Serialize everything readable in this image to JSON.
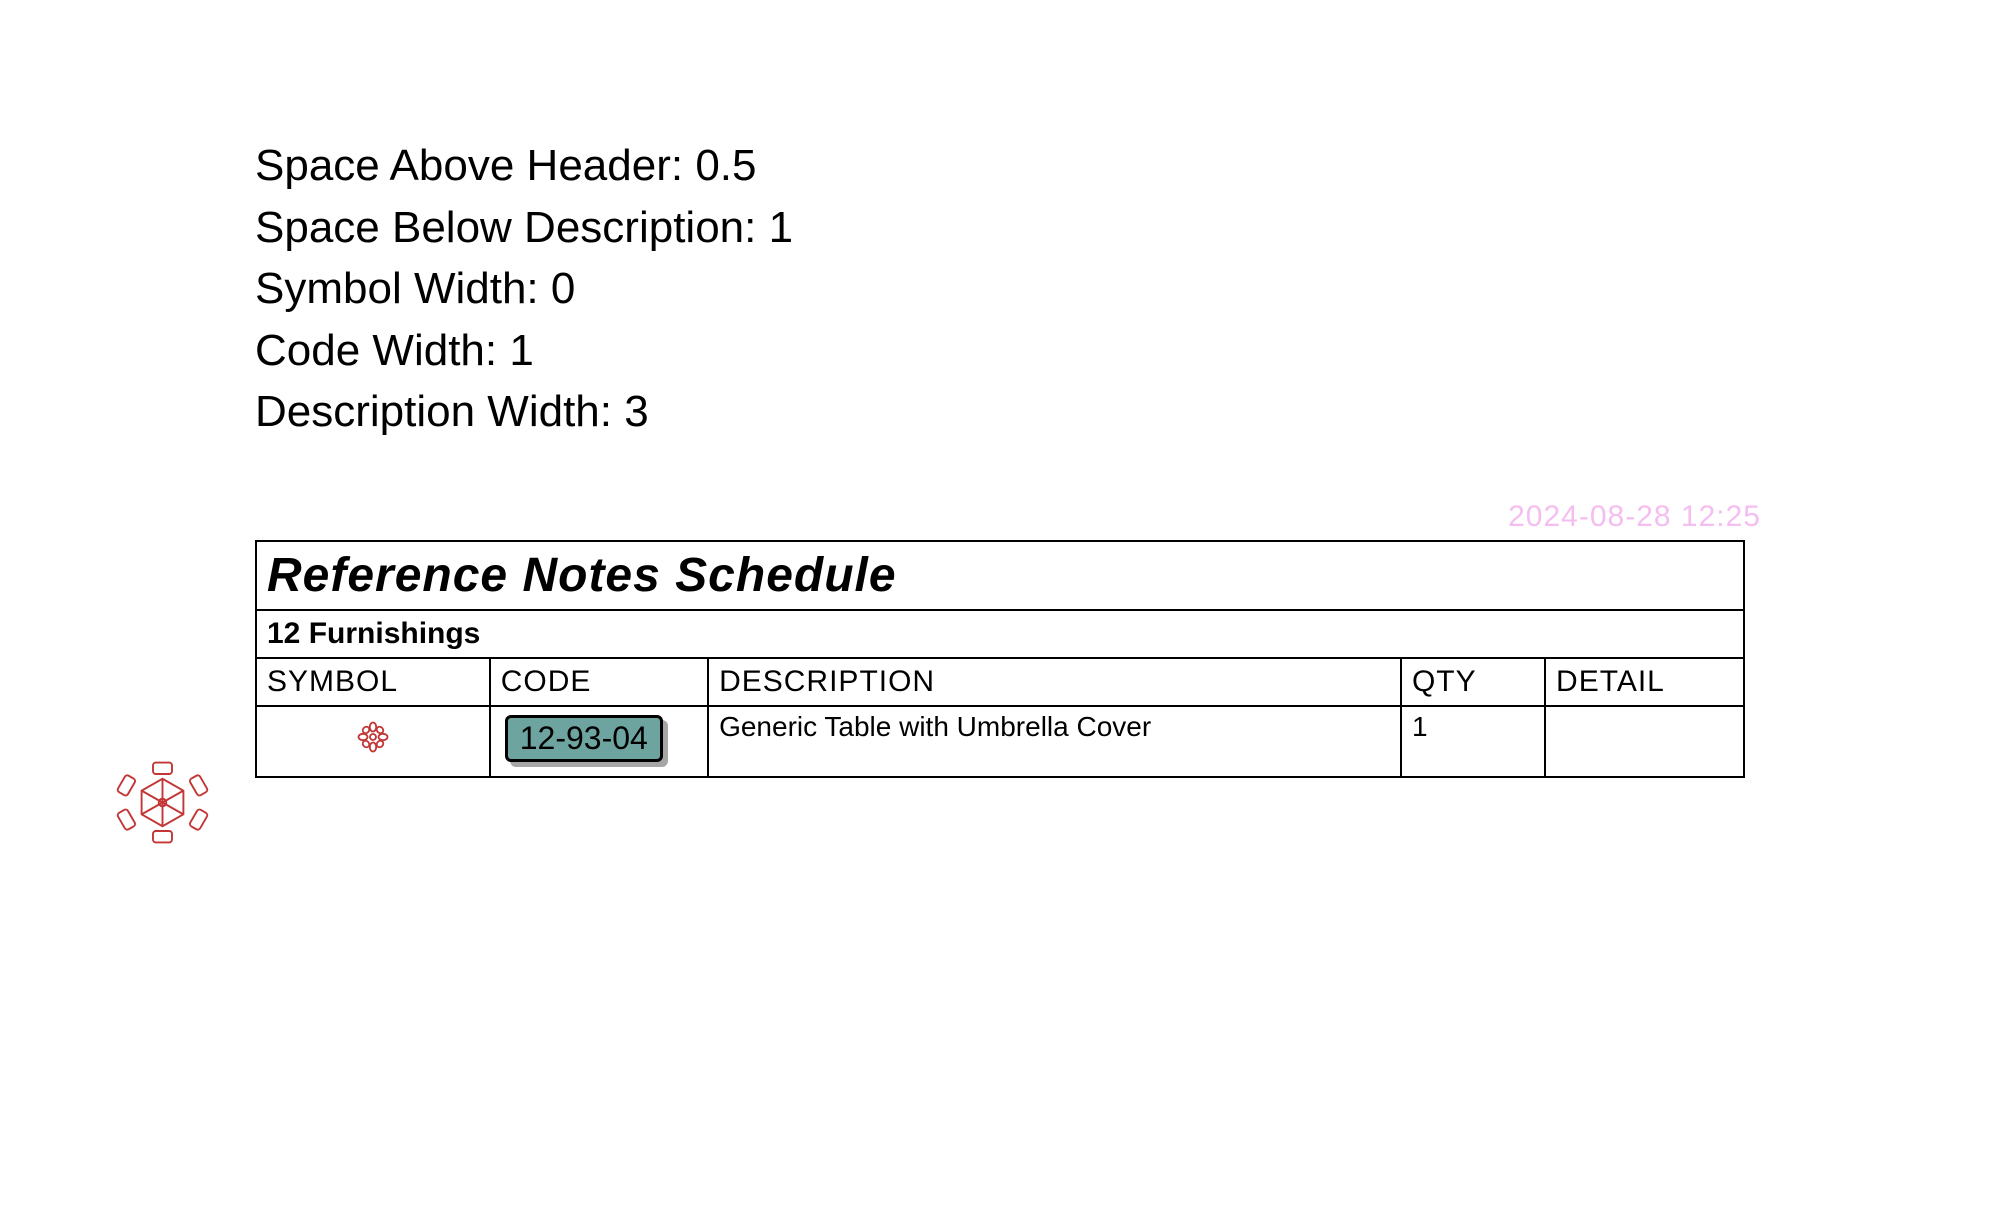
{
  "settings": {
    "space_above_header": {
      "label": "Space Above Header",
      "value": "0.5"
    },
    "space_below_description": {
      "label": "Space Below Description",
      "value": "1"
    },
    "symbol_width": {
      "label": "Symbol Width",
      "value": "0"
    },
    "code_width": {
      "label": "Code Width",
      "value": "1"
    },
    "description_width": {
      "label": "Description Width",
      "value": "3"
    }
  },
  "timestamp": "2024-08-28 12:25",
  "schedule": {
    "title": "Reference Notes Schedule",
    "category": "12 Furnishings",
    "headers": {
      "symbol": "SYMBOL",
      "code": "CODE",
      "description": "DESCRIPTION",
      "qty": "QTY",
      "detail": "DETAIL"
    },
    "rows": [
      {
        "symbol_icon": "table-flower-icon",
        "code": "12-93-04",
        "description": "Generic Table with Umbrella Cover",
        "qty": "1",
        "detail": ""
      }
    ]
  },
  "colors": {
    "icon_red": "#c23636",
    "code_badge_bg": "#6da4a0",
    "timestamp": "#f5bdf0"
  }
}
